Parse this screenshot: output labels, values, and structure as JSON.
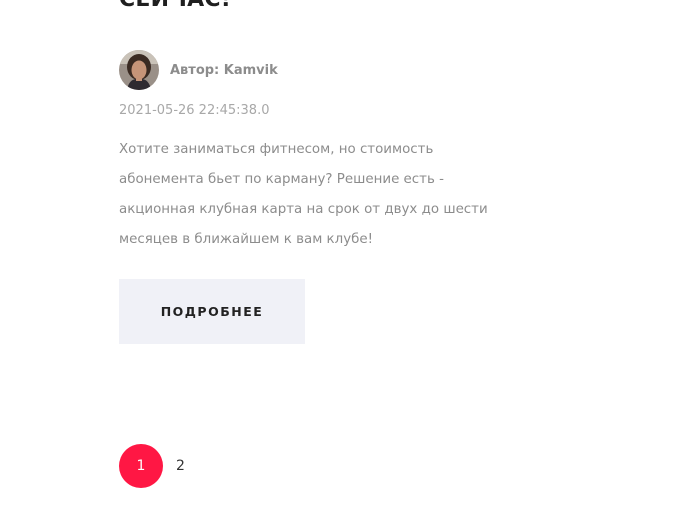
{
  "post": {
    "title_tail": "СЕЙЧАС!",
    "author_label": "Автор: Kamvik",
    "date": "2021-05-26 22:45:38.0",
    "excerpt": "Хотите заниматься фитнесом, но стоимость абонемента бьет по карману? Решение есть - акционная клубная карта на срок от двух до шести месяцев в ближайшем к вам клубе!",
    "more_label": "ПОДРОБНЕЕ"
  },
  "pagination": {
    "current": "1",
    "next": "2"
  },
  "colors": {
    "accent": "#ff1744",
    "button_bg": "#f0f1f7",
    "muted_text": "#8c8c8c"
  }
}
